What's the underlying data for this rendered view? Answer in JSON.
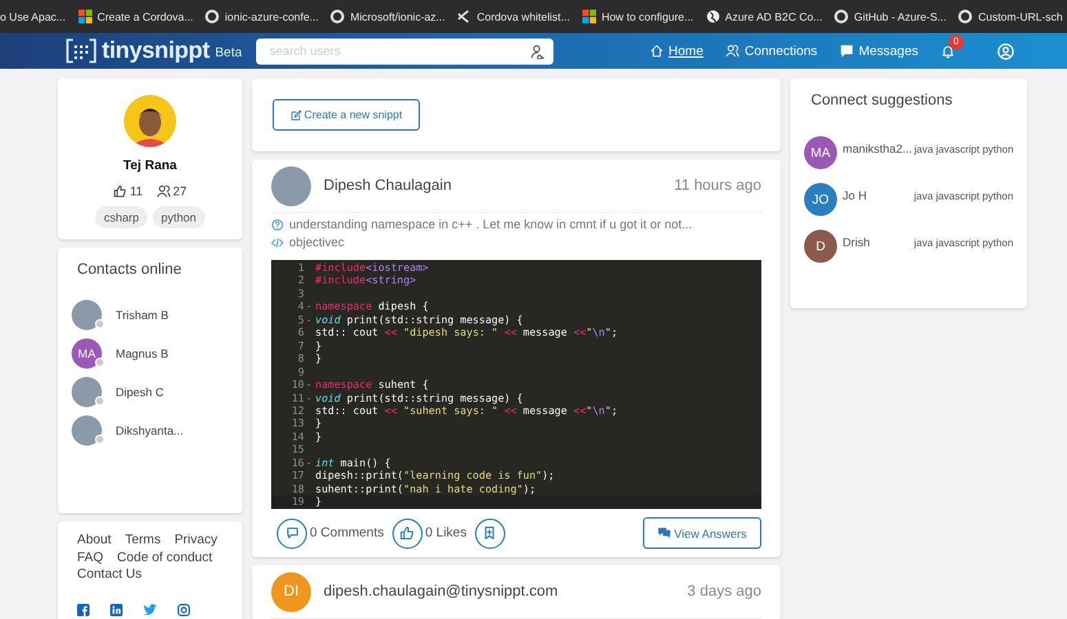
{
  "bookmarks": [
    {
      "label": "o Use Apac...",
      "kind": "none"
    },
    {
      "label": "Create a Cordova...",
      "kind": "windows"
    },
    {
      "label": "ionic-azure-confe...",
      "kind": "github"
    },
    {
      "label": "Microsoft/ionic-az...",
      "kind": "github"
    },
    {
      "label": "Cordova whitelist...",
      "kind": "vscode"
    },
    {
      "label": "How to configure...",
      "kind": "windows"
    },
    {
      "label": "Azure AD B2C Co...",
      "kind": "globe"
    },
    {
      "label": "GitHub - Azure-S...",
      "kind": "github"
    },
    {
      "label": "Custom-URL-sch",
      "kind": "github"
    }
  ],
  "navbar": {
    "logo": "tinysnippt",
    "logo_badge": "Beta",
    "search": {
      "placeholder": "search users"
    },
    "links": [
      {
        "label": "Home",
        "kind": "home",
        "selected": true
      },
      {
        "label": "Connections",
        "kind": "people",
        "selected": false
      },
      {
        "label": "Messages",
        "kind": "chat",
        "selected": false
      }
    ],
    "notifications": "0"
  },
  "profile": {
    "name": "Tej Rana",
    "likes": "11",
    "connections": "27",
    "tags": [
      "csharp",
      "python"
    ]
  },
  "contacts": {
    "title": "Contacts online",
    "items": [
      {
        "name": "Trisham B",
        "kind": "photo"
      },
      {
        "name": "Magnus B",
        "kind": "initials",
        "initials": "MA",
        "color": "#9b59b6"
      },
      {
        "name": "Dipesh C",
        "kind": "photo"
      },
      {
        "name": "Dikshyanta...",
        "kind": "photo"
      }
    ]
  },
  "footer_links": [
    [
      "About",
      "Terms",
      "Privacy"
    ],
    [
      "FAQ",
      "Code of conduct"
    ],
    [
      "Contact Us"
    ]
  ],
  "social": [
    {
      "kind": "facebook"
    },
    {
      "kind": "linkedin"
    },
    {
      "kind": "twitter"
    },
    {
      "kind": "instagram"
    }
  ],
  "create_button": "Create a new snippt",
  "posts": [
    {
      "author": "Dipesh Chaulagain",
      "time": "11 hours ago",
      "kind": "photo",
      "question": "understanding namespace in c++ . Let me know in cmnt if u got it or not...",
      "language": "objectivec",
      "code": [
        {
          "n": "1",
          "tokens": [
            {
              "t": "#include",
              "kind": "kw"
            },
            {
              "t": "<iostream>",
              "kind": "lib"
            }
          ]
        },
        {
          "n": "2",
          "tokens": [
            {
              "t": "#include",
              "kind": "kw"
            },
            {
              "t": "<string>",
              "kind": "lib"
            }
          ]
        },
        {
          "n": "3"
        },
        {
          "n": "4",
          "marker": "-",
          "tokens": [
            {
              "t": "namespace",
              "kind": "kw"
            },
            {
              "t": " dipesh {",
              "kind": "plain"
            }
          ]
        },
        {
          "n": "5",
          "marker": "-",
          "tokens": [
            {
              "t": "void",
              "kind": "type"
            },
            {
              "t": " print(std::string message) {",
              "kind": "plain"
            }
          ]
        },
        {
          "n": "6",
          "tokens": [
            {
              "t": "std:: cout ",
              "kind": "plain"
            },
            {
              "t": "<<",
              "kind": "kw"
            },
            {
              "t": " \"dipesh says: \" ",
              "kind": "str"
            },
            {
              "t": "<<",
              "kind": "kw"
            },
            {
              "t": " message ",
              "kind": "plain"
            },
            {
              "t": "<<",
              "kind": "kw"
            },
            {
              "t": "\"",
              "kind": "str"
            },
            {
              "t": "\\n",
              "kind": "lib"
            },
            {
              "t": "\"",
              "kind": "str"
            },
            {
              "t": ";",
              "kind": "plain"
            }
          ]
        },
        {
          "n": "7",
          "tokens": [
            {
              "t": "}",
              "kind": "plain"
            }
          ]
        },
        {
          "n": "8",
          "tokens": [
            {
              "t": "}",
              "kind": "plain"
            }
          ]
        },
        {
          "n": "9"
        },
        {
          "n": "10",
          "marker": "-",
          "tokens": [
            {
              "t": "namespace",
              "kind": "kw"
            },
            {
              "t": " suhent {",
              "kind": "plain"
            }
          ]
        },
        {
          "n": "11",
          "marker": "-",
          "tokens": [
            {
              "t": "void",
              "kind": "type"
            },
            {
              "t": " print(std::string message) {",
              "kind": "plain"
            }
          ]
        },
        {
          "n": "12",
          "tokens": [
            {
              "t": "std:: cout ",
              "kind": "plain"
            },
            {
              "t": "<<",
              "kind": "kw"
            },
            {
              "t": " \"suhent says: \" ",
              "kind": "str"
            },
            {
              "t": "<<",
              "kind": "kw"
            },
            {
              "t": " message ",
              "kind": "plain"
            },
            {
              "t": "<<",
              "kind": "kw"
            },
            {
              "t": "\"",
              "kind": "str"
            },
            {
              "t": "\\n",
              "kind": "lib"
            },
            {
              "t": "\"",
              "kind": "str"
            },
            {
              "t": ";",
              "kind": "plain"
            }
          ]
        },
        {
          "n": "13",
          "tokens": [
            {
              "t": "}",
              "kind": "plain"
            }
          ]
        },
        {
          "n": "14",
          "tokens": [
            {
              "t": "}",
              "kind": "plain"
            }
          ]
        },
        {
          "n": "15"
        },
        {
          "n": "16",
          "marker": "-",
          "tokens": [
            {
              "t": "int",
              "kind": "type"
            },
            {
              "t": " main() {",
              "kind": "plain"
            }
          ]
        },
        {
          "n": "17",
          "tokens": [
            {
              "t": "dipesh::print(",
              "kind": "plain"
            },
            {
              "t": "\"learning code is fun\"",
              "kind": "str"
            },
            {
              "t": ");",
              "kind": "plain"
            }
          ]
        },
        {
          "n": "18",
          "tokens": [
            {
              "t": "suhent::print(",
              "kind": "plain"
            },
            {
              "t": "\"nah i hate coding\"",
              "kind": "str"
            },
            {
              "t": ");",
              "kind": "plain"
            }
          ]
        },
        {
          "n": "19",
          "tokens": [
            {
              "t": "}",
              "kind": "plain"
            }
          ]
        }
      ],
      "comments": "0 Comments",
      "likes": "0 Likes",
      "answers_button": "View Answers"
    },
    {
      "author": "dipesh.chaulagain@tinysnippt.com",
      "time": "3 days ago",
      "kind": "initials",
      "initials": "DI",
      "color": "#f0961e"
    }
  ],
  "suggestions": {
    "title": "Connect suggestions",
    "items": [
      {
        "name": "manikstha2...",
        "initials": "MA",
        "color": "#9b59b6",
        "tags": "java javascript python"
      },
      {
        "name": "Jo H",
        "initials": "JO",
        "color": "#2a7fc0",
        "tags": "java javascript python"
      },
      {
        "name": "Drish",
        "initials": "D",
        "color": "#8a5a4a",
        "tags": "java javascript python"
      }
    ]
  }
}
